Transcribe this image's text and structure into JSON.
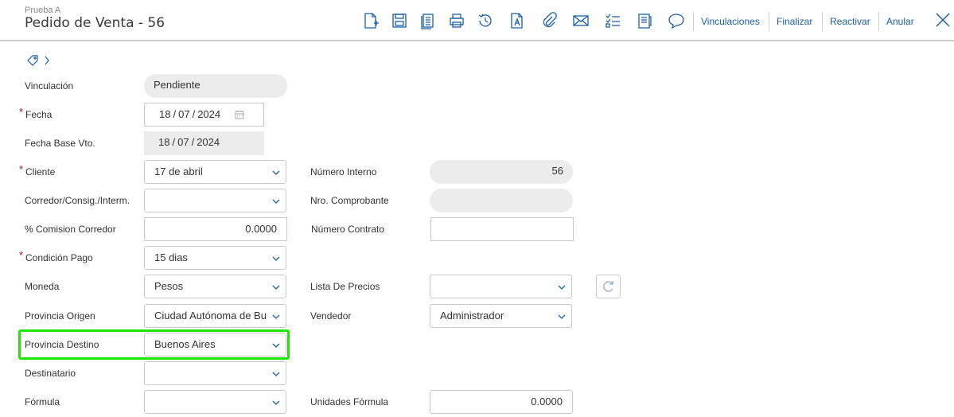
{
  "header": {
    "subtitle": "Prueba A",
    "title": "Pedido de Venta - 56",
    "icons": [
      "new-document-icon",
      "save-icon",
      "copy-icon",
      "print-icon",
      "history-icon",
      "text-document-icon",
      "attach-icon",
      "mail-icon",
      "checklist-icon",
      "report-icon",
      "comment-icon"
    ],
    "links": {
      "vinculaciones": "Vinculaciones",
      "finalizar": "Finalizar",
      "reactivar": "Reactivar",
      "anular": "Anular"
    }
  },
  "colors": {
    "accent": "#1a5fa8",
    "required": "#d0021b",
    "highlight": "#1ee600"
  },
  "form": {
    "vinculacion": {
      "label": "Vinculación",
      "value": "Pendiente"
    },
    "fecha": {
      "label": "Fecha",
      "day": "18",
      "month": "07",
      "year": "2024"
    },
    "fecha_base": {
      "label": "Fecha Base Vto.",
      "day": "18",
      "month": "07",
      "year": "2024"
    },
    "cliente": {
      "label": "Cliente",
      "value": "17 de abril"
    },
    "corredor": {
      "label": "Corredor/Consig./Interm.",
      "value": ""
    },
    "comision": {
      "label": "% Comision Corredor",
      "value": "0.0000"
    },
    "condicion": {
      "label": "Condición Pago",
      "value": "15 dias"
    },
    "moneda": {
      "label": "Moneda",
      "value": "Pesos"
    },
    "prov_origen": {
      "label": "Provincia Origen",
      "value": "Ciudad Autónoma de Bu"
    },
    "prov_destino": {
      "label": "Provincia Destino",
      "value": "Buenos Aires"
    },
    "destinatario": {
      "label": "Destinatario",
      "value": ""
    },
    "formula": {
      "label": "Fórmula",
      "value": ""
    },
    "numero_interno": {
      "label": "Número Interno",
      "value": "56"
    },
    "nro_comprobante": {
      "label": "Nro. Comprobante",
      "value": ""
    },
    "numero_contrato": {
      "label": "Número Contrato",
      "value": ""
    },
    "lista_precios": {
      "label": "Lista De Precios",
      "value": ""
    },
    "vendedor": {
      "label": "Vendedor",
      "value": "Administrador"
    },
    "unidades_formula": {
      "label": "Unidades Fórmula",
      "value": "0.0000"
    }
  }
}
